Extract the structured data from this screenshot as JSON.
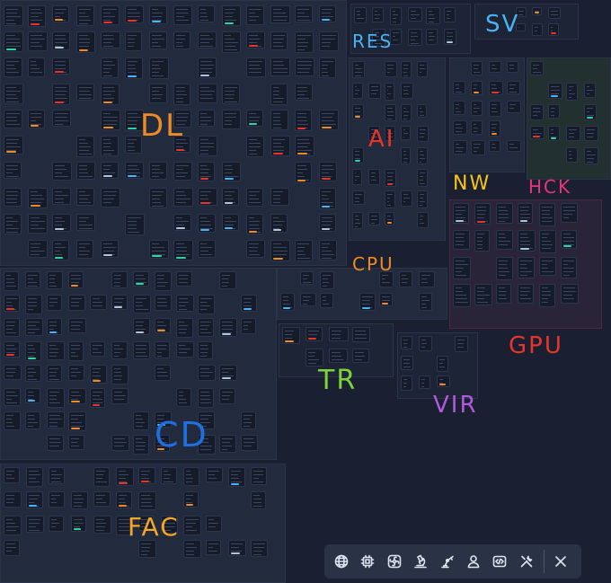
{
  "canvas": {
    "zones": [
      {
        "id": "dl",
        "label": "DL",
        "color": "#f08a24"
      },
      {
        "id": "res",
        "label": "RES",
        "color": "#4ab3f5"
      },
      {
        "id": "sv",
        "label": "SV",
        "color": "#4ab3f5"
      },
      {
        "id": "ai",
        "label": "AI",
        "color": "#e8352a"
      },
      {
        "id": "nw",
        "label": "NW",
        "color": "#f5c518"
      },
      {
        "id": "hck",
        "label": "HCK",
        "color": "#e8357a"
      },
      {
        "id": "cpu",
        "label": "CPU",
        "color": "#f08a24"
      },
      {
        "id": "gpu",
        "label": "GPU",
        "color": "#e8352a"
      },
      {
        "id": "tr",
        "label": "TR",
        "color": "#7cd33a"
      },
      {
        "id": "vir",
        "label": "VIR",
        "color": "#b05ae0"
      },
      {
        "id": "cd",
        "label": "CD",
        "color": "#1f6fe0"
      },
      {
        "id": "fac",
        "label": "FAC",
        "color": "#f5a623"
      }
    ]
  },
  "toolbar": {
    "buttons": [
      {
        "icon": "globe-icon"
      },
      {
        "icon": "cpu-chip-icon"
      },
      {
        "icon": "gpu-fan-icon"
      },
      {
        "icon": "microscope-icon"
      },
      {
        "icon": "robot-arm-icon"
      },
      {
        "icon": "user-icon"
      },
      {
        "icon": "code-icon"
      },
      {
        "icon": "tools-icon"
      },
      {
        "icon": "close-icon"
      }
    ]
  }
}
